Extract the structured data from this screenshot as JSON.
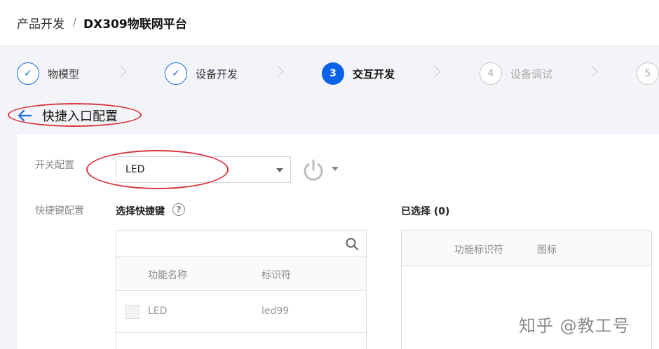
{
  "breadcrumb": {
    "parent": "产品开发",
    "separator": "/",
    "current": "DX309物联网平台"
  },
  "steps": [
    {
      "index": "✓",
      "label": "物模型",
      "state": "done"
    },
    {
      "index": "✓",
      "label": "设备开发",
      "state": "done"
    },
    {
      "index": "3",
      "label": "交互开发",
      "state": "active"
    },
    {
      "index": "4",
      "label": "设备调试",
      "state": "todo"
    },
    {
      "index": "5",
      "label": "",
      "state": "todo"
    }
  ],
  "page": {
    "title": "快捷入口配置"
  },
  "switch_config": {
    "label": "开关配置",
    "selected": "LED",
    "icon": "power-icon"
  },
  "shortcut_config": {
    "label": "快捷键配置",
    "select_title": "选择快捷键",
    "help": "?",
    "search_placeholder": "",
    "columns": [
      "功能名称",
      "标识符"
    ],
    "rows": [
      {
        "name": "LED",
        "id": "led99"
      }
    ]
  },
  "selected": {
    "title": "已选择 (0)",
    "columns": [
      "功能标识符",
      "图标"
    ]
  },
  "watermark": "知乎 @教工号",
  "colors": {
    "primary": "#0a62e6",
    "annotation": "#d9363e"
  }
}
